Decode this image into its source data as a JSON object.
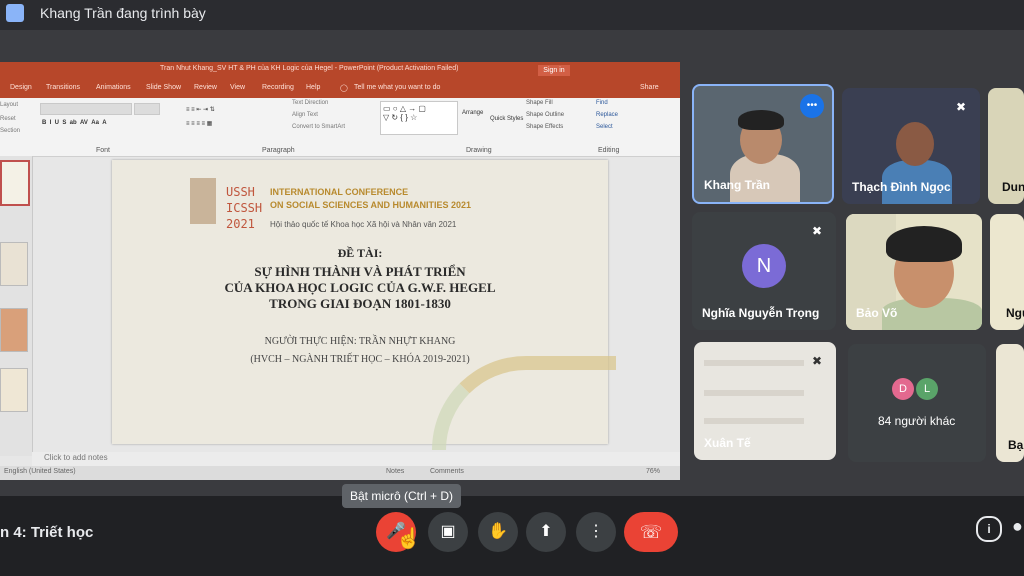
{
  "header": {
    "presenter_text": "Khang Trần đang trình bày"
  },
  "ppt": {
    "window_title": "Tran Nhut Khang_SV HT & PH của KH Logic của Hegel - PowerPoint (Product Activation Failed)",
    "sign_in": "Sign in",
    "tabs": [
      "Design",
      "Transitions",
      "Animations",
      "Slide Show",
      "Review",
      "View",
      "Recording",
      "Help",
      "Tell me what you want to do",
      "Share"
    ],
    "ribbon": {
      "left_items": [
        "Layout",
        "Reset",
        "Section"
      ],
      "groups": [
        "Font",
        "Paragraph",
        "Drawing",
        "Editing"
      ],
      "paragraph_items": [
        "Text Direction",
        "Align Text",
        "Convert to SmartArt"
      ],
      "drawing_items": [
        "Arrange",
        "Quick Styles",
        "Shape Fill",
        "Shape Outline",
        "Shape Effects"
      ],
      "editing_items": [
        "Find",
        "Replace",
        "Select"
      ]
    },
    "notes_placeholder": "Click to add notes",
    "status": {
      "left": "English (United States)",
      "notes": "Notes",
      "comments": "Comments",
      "zoom": "76%"
    },
    "slide": {
      "logo_lines": [
        "USSH",
        "ICSSH",
        "2021"
      ],
      "conference_line1": "INTERNATIONAL CONFERENCE",
      "conference_line2": "ON SOCIAL SCIENCES AND HUMANITIES 2021",
      "conference_vn": "Hội thảo quốc tế Khoa học Xã hội và Nhân văn 2021",
      "topic_label": "ĐỀ TÀI:",
      "title_line1": "SỰ HÌNH THÀNH VÀ PHÁT TRIỂN",
      "title_line2": "CỦA KHOA HỌC LOGIC CỦA G.W.F. HEGEL",
      "title_line3": "TRONG GIAI ĐOẠN 1801-1830",
      "author_line": "NGƯỜI THỰC HIỆN: TRẦN NHỰT KHANG",
      "author_detail": "(HVCH – NGÀNH TRIẾT HỌC – KHÓA 2019-2021)"
    }
  },
  "participants": [
    {
      "name": "Khang Trần"
    },
    {
      "name": "Thạch Đình Ngọc"
    },
    {
      "name": "Dun"
    },
    {
      "name": "Nghĩa Nguyễn Trọng",
      "initial": "N"
    },
    {
      "name": "Bảo Võ"
    },
    {
      "name": "Ngu"
    },
    {
      "name": "Xuân Tế"
    },
    {
      "name": "84 người khác",
      "initials": [
        "D",
        "L"
      ]
    },
    {
      "name": "Bạ"
    }
  ],
  "controls": {
    "meeting_name": "n 4: Triết học",
    "tooltip": "Bật micrô (Ctrl + D)",
    "icons": [
      "mic-off-icon",
      "camera-icon",
      "raise-hand-icon",
      "present-icon",
      "more-icon",
      "end-call-icon"
    ]
  },
  "colors": {
    "accent": "#8ab4f8",
    "danger": "#ea4335",
    "ppt_brand": "#b7472a",
    "background": "#202124"
  }
}
